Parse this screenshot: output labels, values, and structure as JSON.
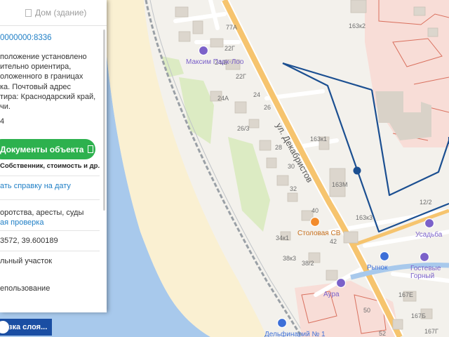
{
  "panel": {
    "tab_label": "Дом (здание)",
    "cadastral_number": "0000000:8336",
    "address_text": "положение установлено\nительно ориентира,\nоложенного в границах\nка. Почтовый адрес\nтира: Краснодарский край,\nчи.",
    "address_tail": "4",
    "documents_button": "Документы объекта",
    "documents_sub": "Собственник, стоимость и др.",
    "certificate_link": "ать справку на дату",
    "debts_text": "оротства, аресты, суды",
    "check_link": "ая проверка",
    "coordinates": "3572, 39.600189",
    "land_type": "льный участок",
    "usage": "епользование"
  },
  "layers_button": "зка слоя...",
  "map": {
    "street_label": "ул. Декабристов",
    "pois": [
      {
        "name": "Максим Парк-Лоо",
        "icon": "hotel-icon"
      },
      {
        "name": "Столовая СВ",
        "icon": "cafe-icon"
      },
      {
        "name": "Рынок",
        "icon": "market-icon"
      },
      {
        "name": "Усадьба",
        "icon": "hotel-icon"
      },
      {
        "name": "Гостевые\nГорный",
        "icon": "hotel-icon"
      },
      {
        "name": "Аура",
        "icon": "hotel-icon"
      },
      {
        "name": "Дельфинарий № 1",
        "icon": "pin-icon"
      }
    ],
    "house_numbers": [
      "77А",
      "22Г",
      "24/Б",
      "22Г",
      "24А",
      "24",
      "26",
      "26/3",
      "28",
      "30",
      "32",
      "34к1",
      "38к3",
      "38/2",
      "40",
      "42",
      "163к2",
      "163к1",
      "163М",
      "163к3",
      "50",
      "52",
      "167Е",
      "167Б",
      "167Г",
      "12/2"
    ],
    "colors": {
      "sea": "#a8c9ec",
      "beach": "#faf0d2",
      "road": "#f6c46e",
      "parcel_outline": "#1b4f91",
      "cadastral_red": "#d9705e"
    }
  }
}
